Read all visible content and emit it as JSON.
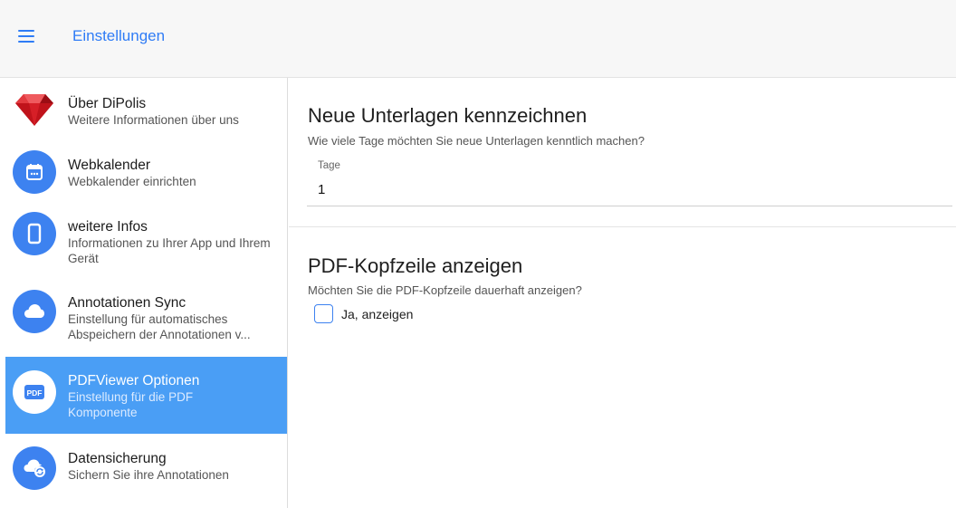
{
  "header": {
    "title": "Einstellungen",
    "menu_icon": "hamburger-menu-icon",
    "accent_color": "#2f7cf6"
  },
  "sidebar": {
    "items": [
      {
        "title": "Über DiPolis",
        "subtitle": "Weitere Informationen über uns",
        "icon": "ruby-gem-icon",
        "active": false
      },
      {
        "title": "Webkalender",
        "subtitle": "Webkalender einrichten",
        "icon": "calendar-icon",
        "active": false
      },
      {
        "title": "weitere Infos",
        "subtitle": "Informationen zu Ihrer App und Ihrem Gerät",
        "icon": "smartphone-icon",
        "active": false
      },
      {
        "title": "Annotationen Sync",
        "subtitle": "Einstellung für automatisches Abspeichern der Annotationen v...",
        "icon": "cloud-icon",
        "active": false
      },
      {
        "title": "PDFViewer Optionen",
        "subtitle": "Einstellung für die PDF Komponente",
        "icon": "pdf-icon",
        "active": true
      },
      {
        "title": "Datensicherung",
        "subtitle": "Sichern Sie ihre Annotationen",
        "icon": "cloud-sync-icon",
        "active": false
      }
    ],
    "active_color": "#4a9ef5",
    "icon_color": "#3d82f0"
  },
  "main": {
    "section1": {
      "title": "Neue Unterlagen kennzeichnen",
      "description": "Wie viele Tage möchten Sie neue Unterlagen kenntlich machen?",
      "field_label": "Tage",
      "field_value": "1"
    },
    "section2": {
      "title": "PDF-Kopfzeile anzeigen",
      "description": "Möchten Sie die PDF-Kopfzeile dauerhaft anzeigen?",
      "checkbox_label": "Ja, anzeigen",
      "checked": false
    }
  }
}
